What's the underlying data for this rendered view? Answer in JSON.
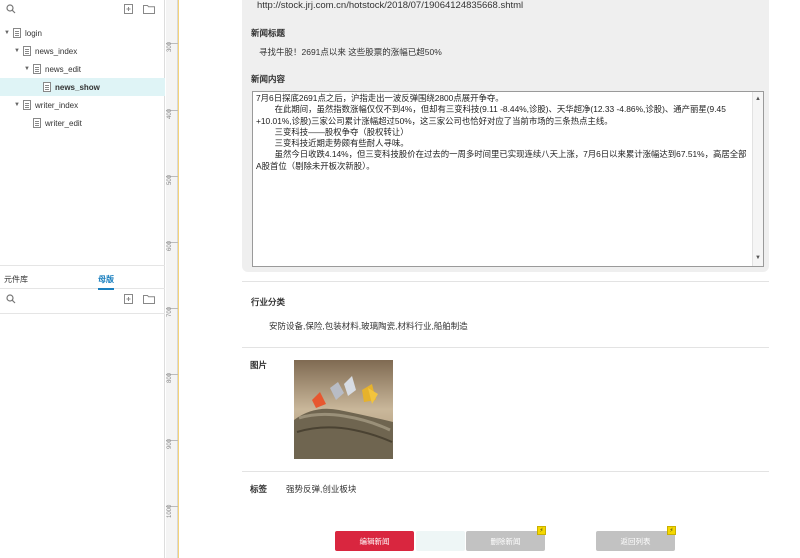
{
  "sidebar": {
    "tree": [
      {
        "label": "login",
        "expanded": true
      },
      {
        "label": "news_index",
        "expanded": true
      },
      {
        "label": "news_edit",
        "expanded": true
      },
      {
        "label": "news_show",
        "selected": true
      },
      {
        "label": "writer_index",
        "expanded": true
      },
      {
        "label": "writer_edit"
      }
    ],
    "tabs": [
      {
        "label": "元件库"
      },
      {
        "label": "母版",
        "active": true
      }
    ]
  },
  "ruler": {
    "labels": [
      "300",
      "400",
      "500",
      "600",
      "700",
      "800",
      "900",
      "1000"
    ]
  },
  "page": {
    "url": "http://stock.jrj.com.cn/hotstock/2018/07/19064124835668.shtml",
    "title_label": "新闻标题",
    "title_value": "寻找牛股！2691点以来 这些股票的涨幅已超50%",
    "content_label": "新闻内容",
    "content_lines": [
      "7月6日探底2691点之后，沪指走出一波反弹围绕2800点展开争夺。",
      "        在此期间，虽然指数涨幅仅仅不到4%，但却有三变科技(9.11 -8.44%,诊股)、天华超净(12.33 -4.86%,诊股)、通产丽星(9.45 +10.01%,诊股)三家公司累计涨幅超过50%，这三家公司也恰好对应了当前市场的三条热点主线。",
      "        三变科技——股权争夺（股权转让）",
      "        三变科技近期走势颇有些耐人寻味。",
      "        虽然今日收跌4.14%，但三变科技股价在过去的一周多时间里已实现连续八天上涨，7月6日以来累计涨幅达到67.51%，高居全部A股首位（剔除未开板次新股）。"
    ],
    "industry_label": "行业分类",
    "industry_value": "安防设备,保险,包装材料,玻璃陶瓷,材料行业,船舶制造",
    "image_label": "图片",
    "tags_label": "标签",
    "tags_value": "强势反弹,创业板块",
    "buttons": {
      "edit": "编辑新闻",
      "delete": "删除新闻",
      "back": "返回列表"
    }
  },
  "colors": {
    "accent_red": "#d9263f",
    "selected_bg": "#dff4f6",
    "tab_active": "#1a7fbf"
  }
}
